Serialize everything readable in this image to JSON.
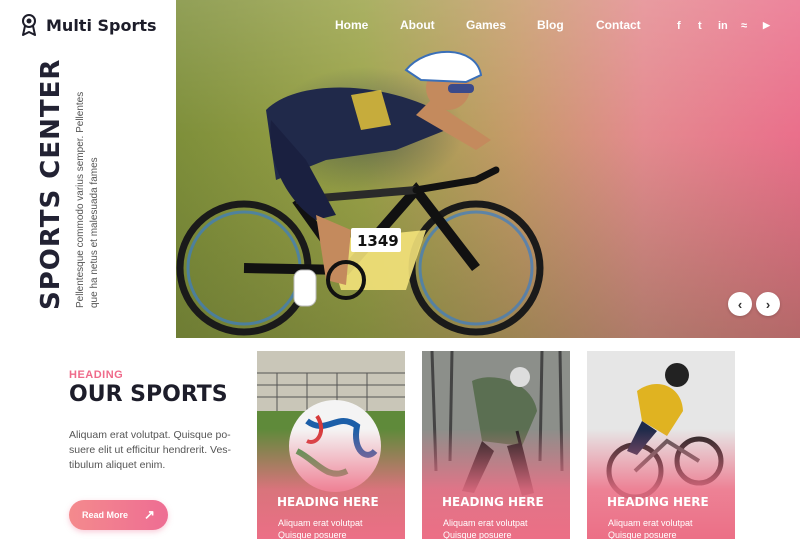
{
  "brand": {
    "name": "Multi Sports"
  },
  "nav": {
    "items": [
      "Home",
      "About",
      "Games",
      "Blog",
      "Contact"
    ]
  },
  "social": [
    "facebook-icon",
    "twitter-icon",
    "linkedin-icon",
    "rss-icon",
    "youtube-icon"
  ],
  "social_glyphs": {
    "facebook": "f",
    "twitter": "t",
    "linkedin": "in",
    "rss": "≈",
    "youtube": "▶"
  },
  "hero": {
    "title": "SPORTS CENTER",
    "description": "Pellentesque commodo varius semper. Pellentes que ha netus et malesuada fames",
    "bib_number": "1349",
    "prev_label": "‹",
    "next_label": "›"
  },
  "section": {
    "kicker": "HEADING",
    "title": "OUR SPORTS",
    "text": "Aliquam erat volutpat. Quisque po-suere elit ut efficitur hendrerit. Ves-tibulum aliquet enim.",
    "button_label": "Read More",
    "button_arrow": "↗"
  },
  "cards": [
    {
      "title": "HEADING HERE",
      "text": "Aliquam erat volutpat Quisque posuere"
    },
    {
      "title": "HEADING HERE",
      "text": "Aliquam erat volutpat Quisque posuere"
    },
    {
      "title": "HEADING HERE",
      "text": "Aliquam erat volutpat Quisque posuere"
    }
  ],
  "colors": {
    "accent": "#ee6d93",
    "dark": "#1d1d2a"
  }
}
